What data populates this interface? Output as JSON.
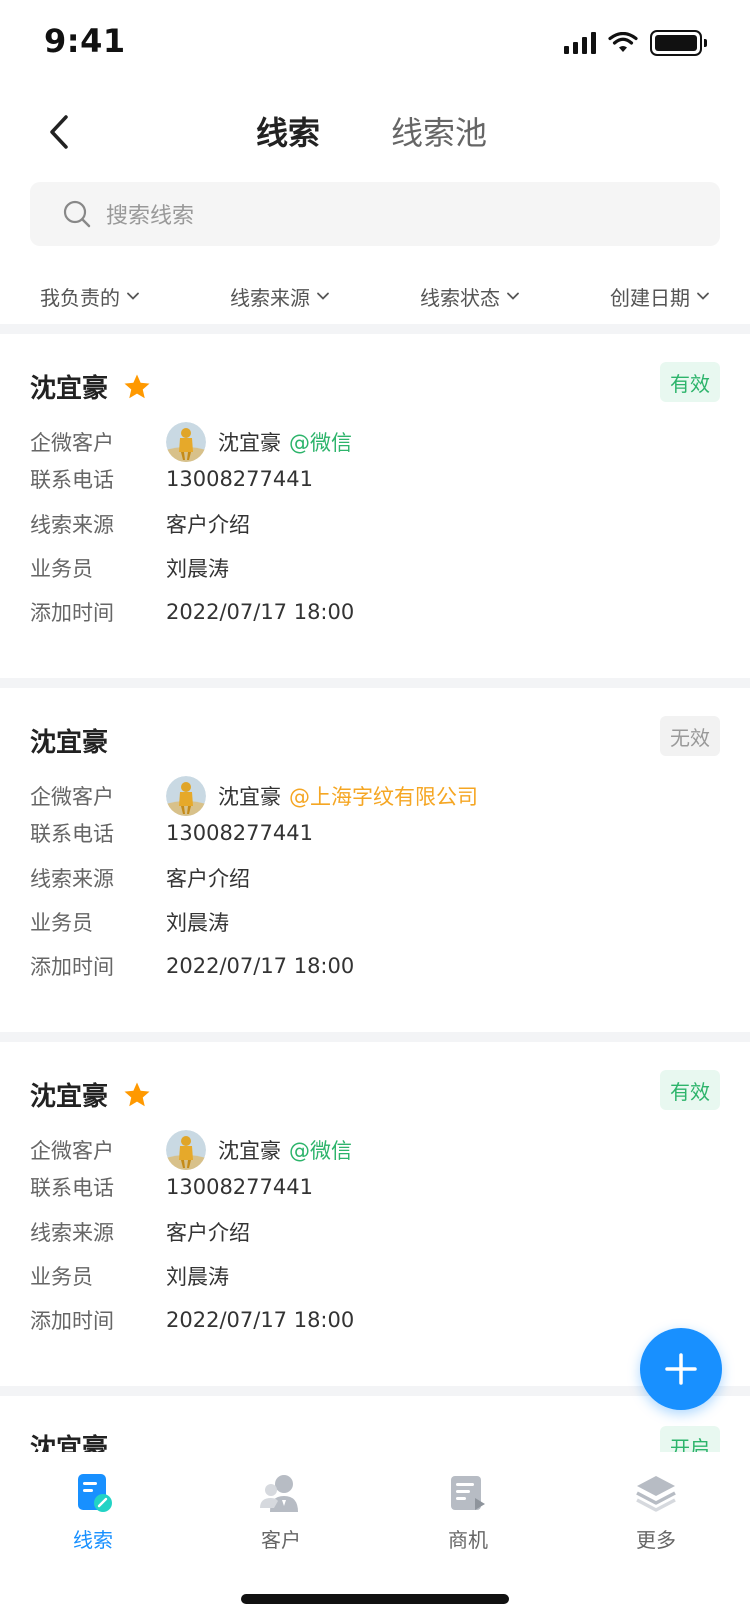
{
  "status_bar": {
    "time": "9:41"
  },
  "header": {
    "tabs": [
      {
        "label": "线索",
        "active": true
      },
      {
        "label": "线索池",
        "active": false
      }
    ]
  },
  "search": {
    "placeholder": "搜索线索"
  },
  "filters": [
    "我负责的",
    "线索来源",
    "线索状态",
    "创建日期"
  ],
  "field_labels": {
    "customer": "企微客户",
    "phone": "联系电话",
    "source": "线索来源",
    "salesperson": "业务员",
    "added_time": "添加时间"
  },
  "cards": [
    {
      "name": "沈宜豪",
      "starred": true,
      "status": "有效",
      "status_type": "valid",
      "customer_name": "沈宜豪",
      "customer_from": "@微信",
      "phone": "13008277441",
      "source": "客户介绍",
      "salesperson": "刘晨涛",
      "added_time": "2022/07/17 18:00"
    },
    {
      "name": "沈宜豪",
      "starred": false,
      "status": "无效",
      "status_type": "invalid",
      "customer_name": "沈宜豪",
      "customer_from": "@上海字纹有限公司",
      "phone": "13008277441",
      "source": "客户介绍",
      "salesperson": "刘晨涛",
      "added_time": "2022/07/17 18:00"
    },
    {
      "name": "沈宜豪",
      "starred": true,
      "status": "有效",
      "status_type": "valid",
      "customer_name": "沈宜豪",
      "customer_from": "@微信",
      "phone": "13008277441",
      "source": "客户介绍",
      "salesperson": "刘晨涛",
      "added_time": "2022/07/17 18:00"
    },
    {
      "name": "沈宜豪",
      "status": "开启",
      "status_type": "open"
    }
  ],
  "tabbar": {
    "items": [
      {
        "label": "线索",
        "icon": "leads-icon",
        "active": true
      },
      {
        "label": "客户",
        "icon": "customer-icon",
        "active": false
      },
      {
        "label": "商机",
        "icon": "opportunity-icon",
        "active": false
      },
      {
        "label": "更多",
        "icon": "more-icon",
        "active": false
      }
    ]
  },
  "colors": {
    "primary": "#1890ff",
    "valid": "#2db46b",
    "orange": "#f5a623",
    "star": "#ff9900"
  }
}
